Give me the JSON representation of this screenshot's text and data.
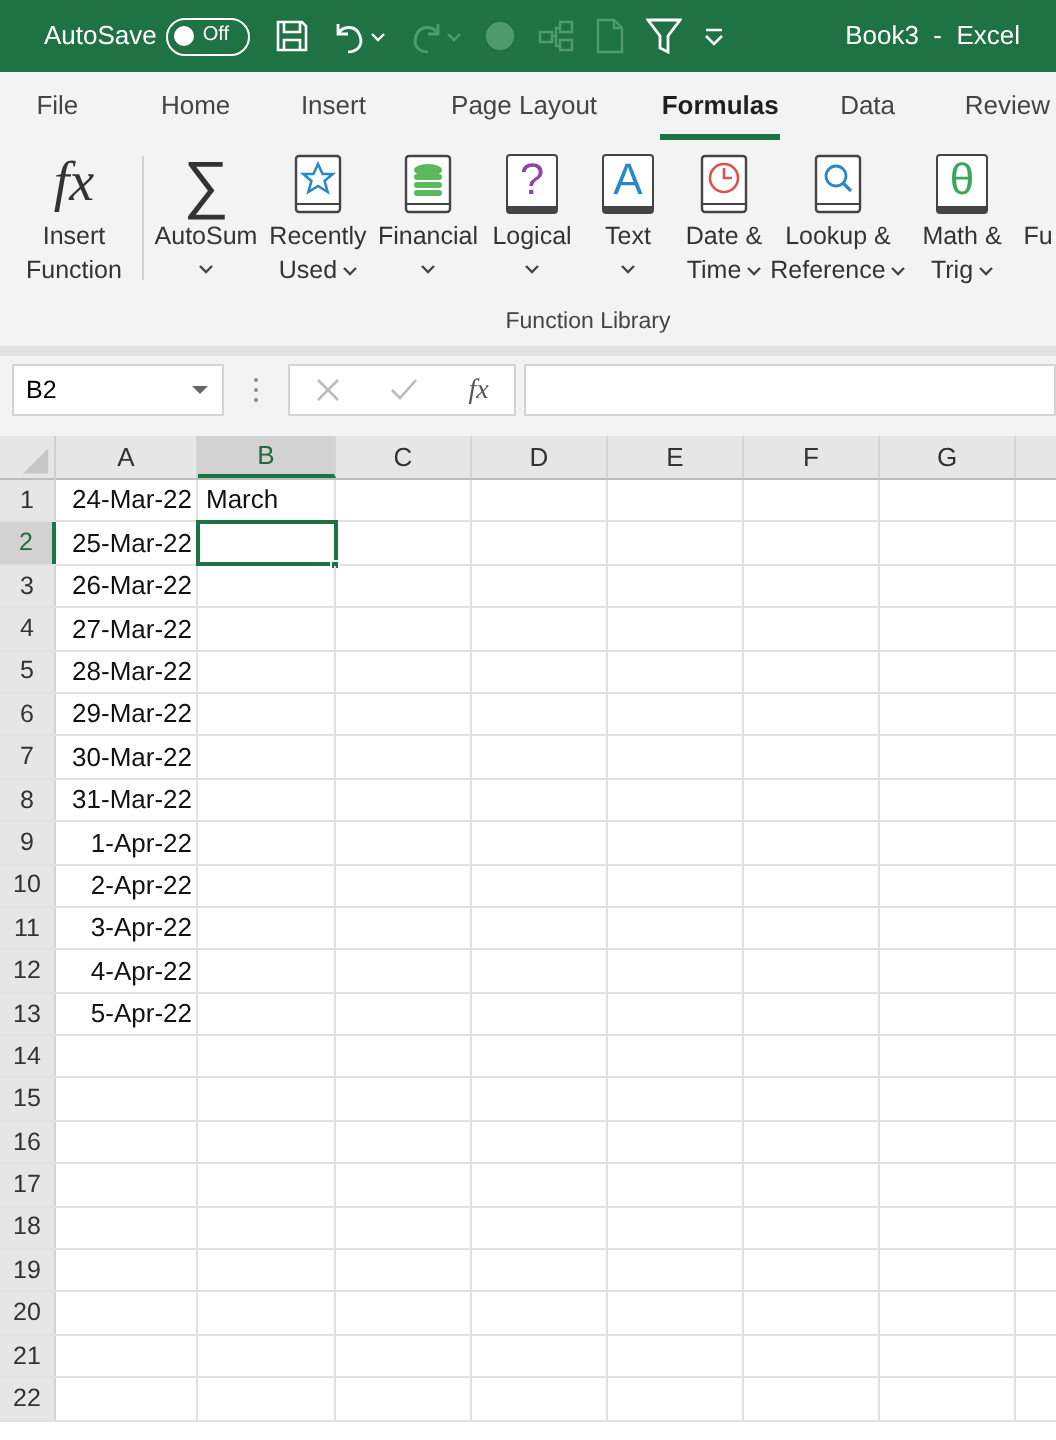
{
  "title_bar": {
    "autosave_label": "AutoSave",
    "autosave_toggle": {
      "label": "Off",
      "on": false
    },
    "title": "Book3  -  Excel"
  },
  "tabs": [
    {
      "label": "File",
      "selected": false
    },
    {
      "label": "Home",
      "selected": false
    },
    {
      "label": "Insert",
      "selected": false
    },
    {
      "label": "Page Layout",
      "selected": false
    },
    {
      "label": "Formulas",
      "selected": true
    },
    {
      "label": "Data",
      "selected": false
    },
    {
      "label": "Review",
      "selected": false
    }
  ],
  "ribbon": {
    "buttons": [
      {
        "kind": "fx",
        "glyph": "fx",
        "lines": [
          "Insert",
          "Function"
        ],
        "dropdown": false
      },
      {
        "kind": "sigma",
        "glyph": "∑",
        "lines": [
          "AutoSum"
        ],
        "dropdown": true
      },
      {
        "kind": "star",
        "lines": [
          "Recently",
          "Used"
        ],
        "dropdown": true
      },
      {
        "kind": "coins",
        "lines": [
          "Financial"
        ],
        "dropdown": true
      },
      {
        "kind": "glyph-book",
        "glyph": "?",
        "color": "#8e44ad",
        "lines": [
          "Logical"
        ],
        "dropdown": true
      },
      {
        "kind": "glyph-book",
        "glyph": "A",
        "color": "#2b88c8",
        "lines": [
          "Text"
        ],
        "dropdown": true
      },
      {
        "kind": "clock",
        "lines": [
          "Date &",
          "Time"
        ],
        "dropdown": true
      },
      {
        "kind": "lens",
        "lines": [
          "Lookup &",
          "Reference"
        ],
        "dropdown": true
      },
      {
        "kind": "glyph-book",
        "glyph": "θ",
        "color": "#3aa55d",
        "lines": [
          "Math &",
          "Trig"
        ],
        "dropdown": true
      },
      {
        "kind": "partial",
        "lines": [
          "Fu"
        ],
        "dropdown": false
      }
    ],
    "group_label": "Function Library"
  },
  "name_box": {
    "value": "B2"
  },
  "formula_bar": {
    "function_symbol": "fx"
  },
  "columns": [
    {
      "label": "A",
      "selected": false
    },
    {
      "label": "B",
      "selected": true
    },
    {
      "label": "C",
      "selected": false
    },
    {
      "label": "D",
      "selected": false
    },
    {
      "label": "E",
      "selected": false
    },
    {
      "label": "F",
      "selected": false
    },
    {
      "label": "G",
      "selected": false
    }
  ],
  "rows": [
    {
      "number": "1",
      "selected": false,
      "a": "24-Mar-22",
      "b": "March"
    },
    {
      "number": "2",
      "selected": true,
      "a": "25-Mar-22"
    },
    {
      "number": "3",
      "selected": false,
      "a": "26-Mar-22"
    },
    {
      "number": "4",
      "selected": false,
      "a": "27-Mar-22"
    },
    {
      "number": "5",
      "selected": false,
      "a": "28-Mar-22"
    },
    {
      "number": "6",
      "selected": false,
      "a": "29-Mar-22"
    },
    {
      "number": "7",
      "selected": false,
      "a": "30-Mar-22"
    },
    {
      "number": "8",
      "selected": false,
      "a": "31-Mar-22"
    },
    {
      "number": "9",
      "selected": false,
      "a": "1-Apr-22"
    },
    {
      "number": "10",
      "selected": false,
      "a": "2-Apr-22"
    },
    {
      "number": "11",
      "selected": false,
      "a": "3-Apr-22"
    },
    {
      "number": "12",
      "selected": false,
      "a": "4-Apr-22"
    },
    {
      "number": "13",
      "selected": false,
      "a": "5-Apr-22"
    },
    {
      "number": "14",
      "selected": false
    },
    {
      "number": "15",
      "selected": false
    },
    {
      "number": "16",
      "selected": false
    },
    {
      "number": "17",
      "selected": false
    },
    {
      "number": "18",
      "selected": false
    },
    {
      "number": "19",
      "selected": false
    },
    {
      "number": "20",
      "selected": false
    },
    {
      "number": "21",
      "selected": false
    },
    {
      "number": "22",
      "selected": false
    }
  ]
}
